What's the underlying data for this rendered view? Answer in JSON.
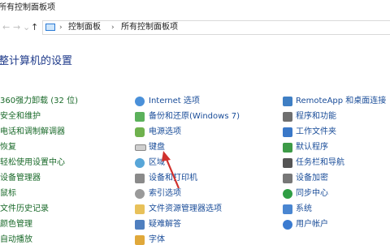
{
  "window": {
    "title": "所有控制面板项"
  },
  "nav": {
    "back": "←",
    "forward": "→",
    "recent": "⌄",
    "up": "↑",
    "breadcrumb": [
      "控制面板",
      "所有控制面板项"
    ],
    "separator": "›"
  },
  "heading": "整计算机的设置",
  "columns": {
    "left": [
      "360强力卸载 (32 位)",
      "安全和维护",
      "电话和调制解调器",
      "恢复",
      "轻松使用设置中心",
      "设备管理器",
      "鼠标",
      "文件历史记录",
      "颜色管理",
      "自动播放"
    ],
    "middle": [
      "Internet 选项",
      "备份和还原(Windows 7)",
      "电源选项",
      "键盘",
      "区域",
      "设备和打印机",
      "索引选项",
      "文件资源管理器选项",
      "疑难解答",
      "字体"
    ],
    "right": [
      "RemoteApp 和桌面连接",
      "程序和功能",
      "工作文件夹",
      "默认程序",
      "任务栏和导航",
      "设备加密",
      "同步中心",
      "系统",
      "用户帐户"
    ]
  },
  "icons": {
    "middle": [
      "internet-options-icon",
      "backup-restore-icon",
      "power-options-icon",
      "keyboard-icon",
      "region-icon",
      "devices-printers-icon",
      "indexing-options-icon",
      "file-explorer-options-icon",
      "troubleshooting-icon",
      "fonts-icon"
    ],
    "right": [
      "remoteapp-icon",
      "programs-features-icon",
      "work-folders-icon",
      "default-programs-icon",
      "taskbar-navigation-icon",
      "device-encryption-icon",
      "sync-center-icon",
      "system-icon",
      "user-accounts-icon"
    ]
  },
  "colors": {
    "link_green": "#1a6a2a",
    "link_blue": "#1a4d99",
    "heading": "#1e3a8a",
    "arrow": "#d0312d"
  }
}
